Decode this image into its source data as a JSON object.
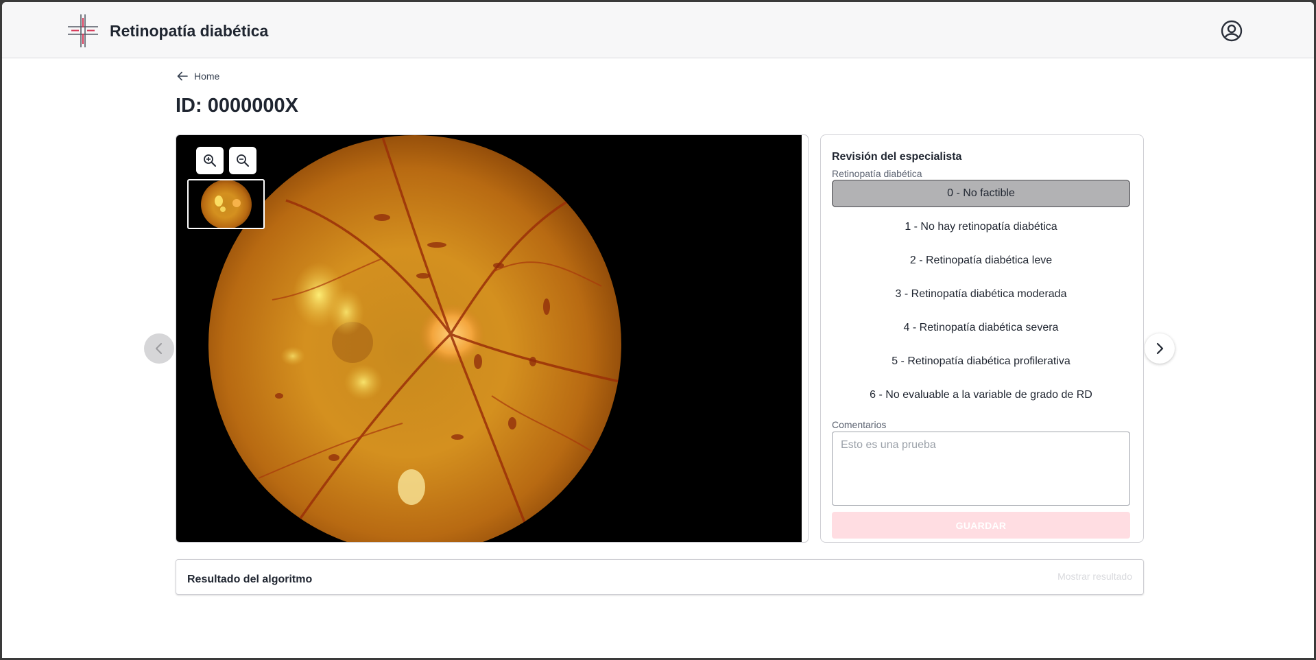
{
  "header": {
    "app_title": "Retinopatía diabética",
    "logo_icon": "cross-medical-logo",
    "user_icon": "user-circle-icon"
  },
  "breadcrumb": {
    "back_label": "Home",
    "back_icon": "arrow-left-icon"
  },
  "page": {
    "title": "ID: 0000000X"
  },
  "viewer": {
    "zoom_in_icon": "zoom-in-icon",
    "zoom_out_icon": "zoom-out-icon",
    "prev_icon": "chevron-left-icon",
    "next_icon": "chevron-right-icon"
  },
  "review": {
    "title": "Revisión del especialista",
    "field_label": "Retinopatía diabética",
    "options": [
      "0 - No factible",
      "1 - No hay retinopatía diabética",
      "2 - Retinopatía diabética leve",
      "3 - Retinopatía diabética moderada",
      "4 - Retinopatía diabética severa",
      "5 - Retinopatía diabética profilerativa",
      "6 - No evaluable a la variable de grado de RD"
    ],
    "selected_option": "0 - No factible",
    "comments_label": "Comentarios",
    "comments_placeholder": "Esto es una prueba",
    "save_label": "GUARDAR"
  },
  "result": {
    "title": "Resultado del algoritmo",
    "toggle_label": "Mostrar resultado"
  },
  "colors": {
    "accent_pink": "#ffdde2",
    "logo_red": "#d63a5a",
    "selected_bg": "#b2b2b4"
  }
}
